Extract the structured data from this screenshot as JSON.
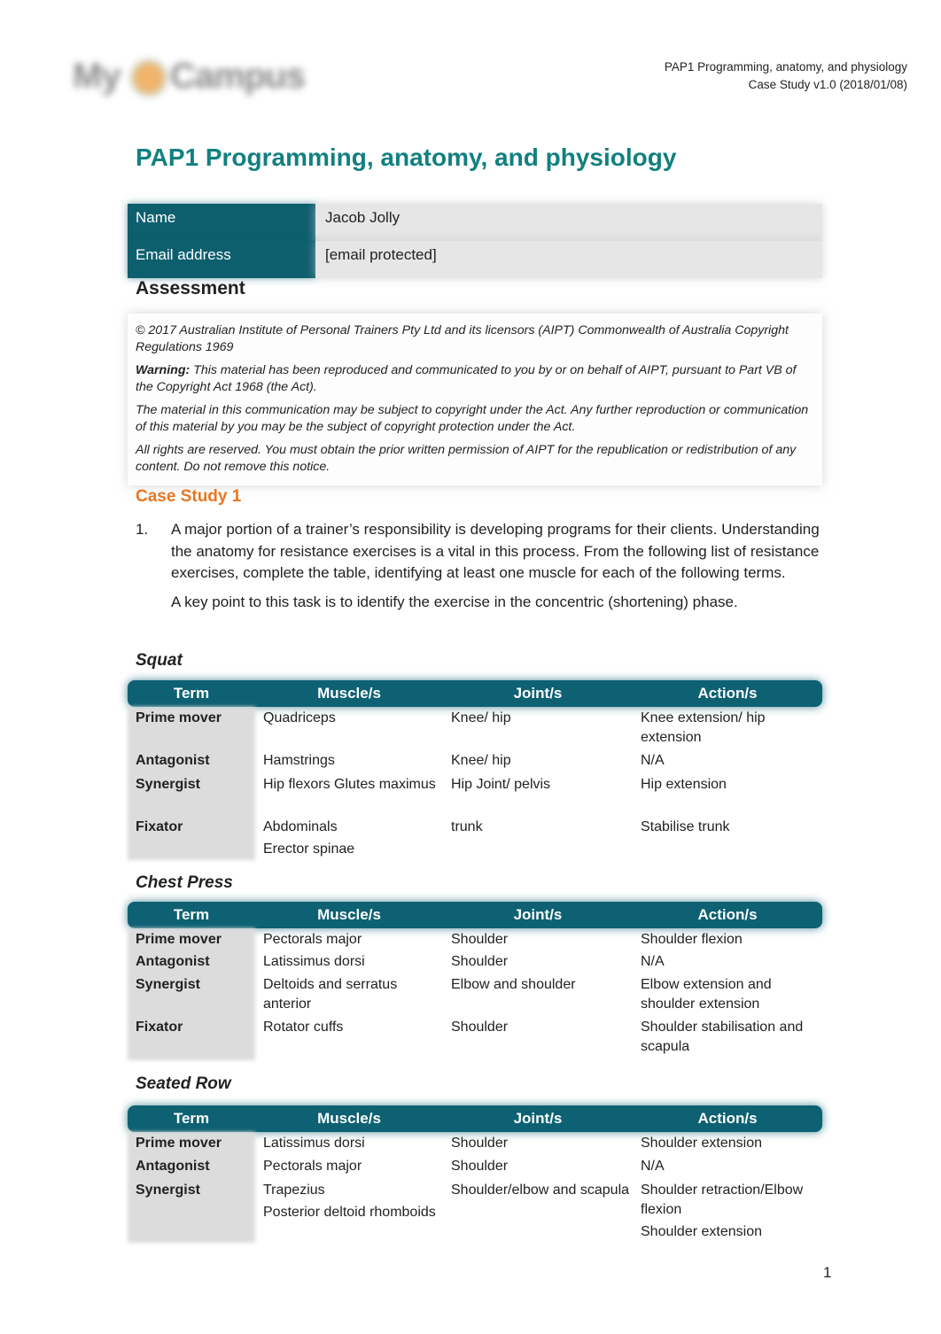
{
  "logo": {
    "part1": "My",
    "part2": "Campus"
  },
  "running_head": {
    "line1": "PAP1 Programming, anatomy, and physiology",
    "line2": "Case Study v1.0 (2018/01/08)"
  },
  "title": "PAP1 Programming, anatomy, and physiology",
  "student": {
    "name_label": "Name",
    "name_value": "Jacob Jolly",
    "email_label": "Email address",
    "email_value": "[email protected]"
  },
  "assessment_heading": "Assessment",
  "copyright": {
    "p1": "© 2017 Australian Institute of Personal Trainers Pty Ltd and its licensors (AIPT) Commonwealth of Australia Copyright Regulations 1969",
    "warning_label": "Warning:",
    "p2": " This material has been reproduced and communicated to you by or on behalf of AIPT, pursuant to Part VB of the Copyright Act 1968 (the Act).",
    "p3": "The material in this communication may be subject to copyright under the Act. Any further reproduction or communication of this material by you may be the subject of copyright protection under the Act.",
    "p4": "All rights are reserved. You must obtain the prior written permission of AIPT for the republication or redistribution of any content. Do not remove this notice."
  },
  "case_study_heading": "Case Study 1",
  "question": {
    "number": "1.",
    "paragraph1": "A major portion of a trainer’s responsibility is developing programs for their clients. Understanding the anatomy for resistance exercises is a vital in this process. From the following list of resistance exercises, complete the table, identifying at least one muscle for each of the following terms.",
    "paragraph2": "A key point to this task is to identify the exercise in the concentric (shortening) phase."
  },
  "table_headers": [
    "Term",
    "Muscle/s",
    "Joint/s",
    "Action/s"
  ],
  "exercises": [
    {
      "name": "Squat",
      "rows": [
        {
          "term": "Prime mover",
          "muscles": [
            "Quadriceps"
          ],
          "joints": [
            "Knee/ hip"
          ],
          "actions": [
            "Knee extension/ hip extension"
          ]
        },
        {
          "term": "Antagonist",
          "muscles": [
            "Hamstrings"
          ],
          "joints": [
            "Knee/ hip"
          ],
          "actions": [
            "N/A"
          ]
        },
        {
          "term": "Synergist",
          "muscles": [
            "Hip flexors Glutes maximus"
          ],
          "joints": [
            "Hip Joint/ pelvis"
          ],
          "actions": [
            "Hip extension"
          ]
        },
        {
          "term": "Fixator",
          "muscles": [
            "Abdominals",
            "Erector spinae"
          ],
          "joints": [
            "trunk"
          ],
          "actions": [
            "Stabilise trunk"
          ]
        }
      ]
    },
    {
      "name": "Chest Press",
      "rows": [
        {
          "term": "Prime mover",
          "muscles": [
            "Pectorals major"
          ],
          "joints": [
            "Shoulder"
          ],
          "actions": [
            "Shoulder flexion"
          ]
        },
        {
          "term": "Antagonist",
          "muscles": [
            "Latissimus dorsi"
          ],
          "joints": [
            "Shoulder"
          ],
          "actions": [
            "N/A"
          ]
        },
        {
          "term": "Synergist",
          "muscles": [
            "Deltoids and serratus anterior"
          ],
          "joints": [
            "Elbow and shoulder"
          ],
          "actions": [
            "Elbow extension and shoulder extension"
          ]
        },
        {
          "term": "Fixator",
          "muscles": [
            "Rotator cuffs"
          ],
          "joints": [
            "Shoulder"
          ],
          "actions": [
            "Shoulder stabilisation and scapula"
          ]
        }
      ]
    },
    {
      "name": "Seated Row",
      "rows": [
        {
          "term": "Prime mover",
          "muscles": [
            "Latissimus dorsi"
          ],
          "joints": [
            "Shoulder"
          ],
          "actions": [
            "Shoulder extension"
          ]
        },
        {
          "term": "Antagonist",
          "muscles": [
            "Pectorals major"
          ],
          "joints": [
            "Shoulder"
          ],
          "actions": [
            "N/A"
          ]
        },
        {
          "term": "Synergist",
          "muscles": [
            "Trapezius",
            "Posterior deltoid rhomboids"
          ],
          "joints": [
            " Shoulder/elbow and scapula"
          ],
          "actions": [
            "Shoulder retraction/Elbow flexion",
            "Shoulder extension"
          ]
        }
      ]
    }
  ],
  "page_number": "1"
}
